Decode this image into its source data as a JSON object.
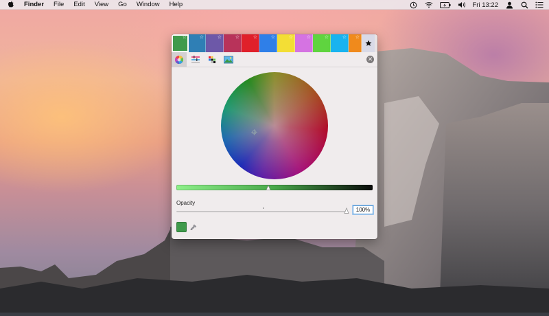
{
  "menubar": {
    "apple_icon": "apple-icon",
    "app_name": "Finder",
    "items": [
      "File",
      "Edit",
      "View",
      "Go",
      "Window",
      "Help"
    ],
    "status_icons": [
      "time-machine-icon",
      "wifi-icon",
      "battery-icon",
      "volume-icon"
    ],
    "clock": "Fri 13:22",
    "right_icons": [
      "user-icon",
      "spotlight-icon",
      "notification-center-icon"
    ]
  },
  "colors_panel": {
    "swatches": [
      {
        "color": "#3f9a4b",
        "selected": true
      },
      {
        "color": "#2f7fb5"
      },
      {
        "color": "#6d58a8"
      },
      {
        "color": "#b8335a"
      },
      {
        "color": "#e0202a"
      },
      {
        "color": "#2f7fe8"
      },
      {
        "color": "#f3de35"
      },
      {
        "color": "#d573e2"
      },
      {
        "color": "#5fd43f"
      },
      {
        "color": "#19b3ef"
      },
      {
        "color": "#f08a1c"
      }
    ],
    "favorite_button_icon": "star-icon",
    "modes": [
      "color-wheel-icon",
      "sliders-icon",
      "palettes-icon",
      "image-palettes-icon"
    ],
    "active_mode": "color-wheel-icon",
    "brightness_level": 0.47,
    "opacity_label": "Opacity",
    "opacity_value": "100%",
    "opacity_level": 1.0,
    "current_color": "#3f9a4b"
  }
}
